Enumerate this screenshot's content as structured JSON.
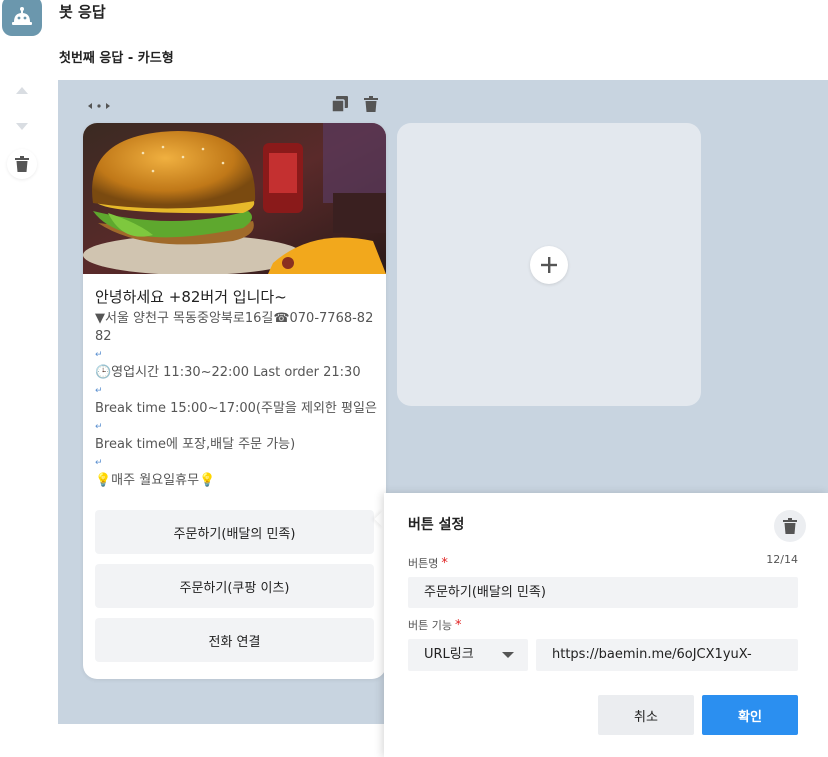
{
  "header": {
    "title": "봇 응답",
    "subtitle": "첫번째 응답 - 카드형"
  },
  "sidebar": {
    "icons": [
      "arrow-up-icon",
      "arrow-down-icon",
      "trash-icon"
    ]
  },
  "card": {
    "title": "안녕하세요 +82버거 입니다~",
    "desc": {
      "address": "▼서울 양천구 목동중앙북로16길☎070-7768-8282",
      "hours": "🕒영업시간 11:30~22:00 Last order 21:30",
      "break1": "Break time 15:00~17:00(주말을 제외한 평일은",
      "break2": "Break time에 포장,배달 주문 가능)",
      "holiday": "💡매주 월요일휴무💡",
      "return_mark": "↵"
    },
    "buttons": [
      "주문하기(배달의 민족)",
      "주문하기(쿠팡 이츠)",
      "전화 연결"
    ]
  },
  "popup": {
    "title": "버튼 설정",
    "name_label": "버튼명",
    "required_mark": "*",
    "char_count": "12/14",
    "name_value": "주문하기(배달의 민족)",
    "func_label": "버튼 기능",
    "func_value": "URL링크",
    "url_value": "https://baemin.me/6oJCX1yuX-",
    "cancel_label": "취소",
    "confirm_label": "확인"
  },
  "colors": {
    "canvas_bg": "#c8d4e0",
    "avatar_bg": "#6b97ad",
    "accent": "#2b8ff0",
    "required": "#e02020"
  }
}
